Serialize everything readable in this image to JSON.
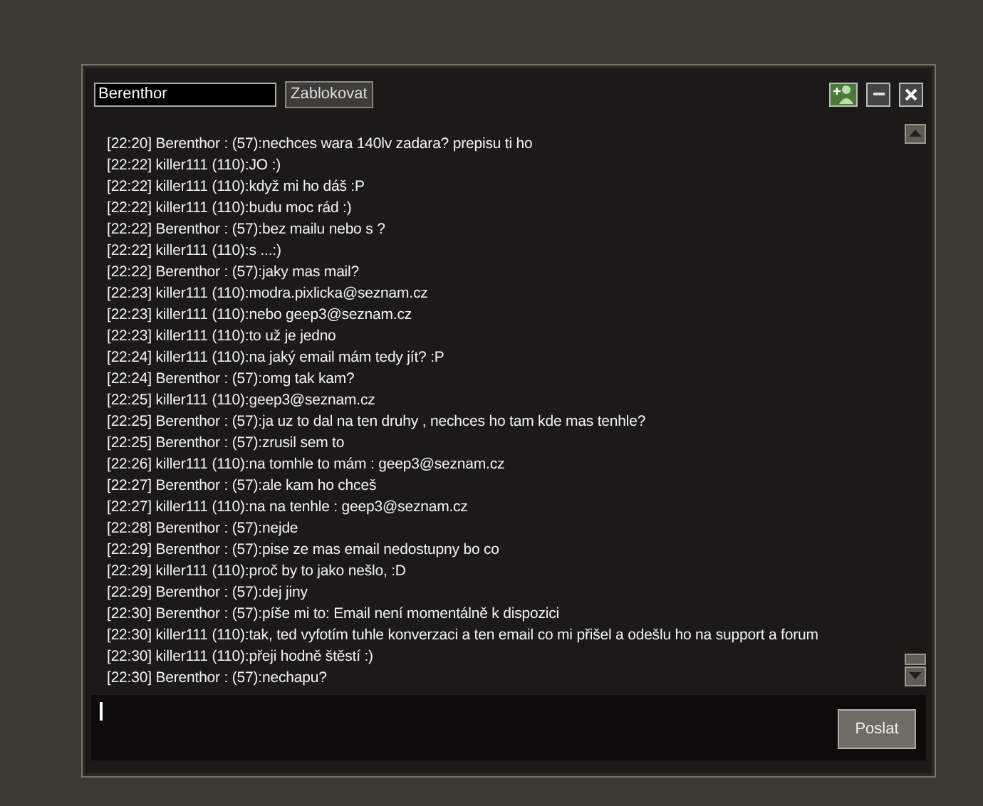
{
  "header": {
    "name_field": "Berenthor",
    "block_button": "Zablokovat"
  },
  "messages": [
    "[22:20] Berenthor : (57):nechces wara 140lv zadara? prepisu ti ho",
    "[22:22] killer111 (110):JO :)",
    "[22:22] killer111 (110):když mi ho dáš :P",
    "[22:22] killer111 (110):budu moc rád :)",
    "[22:22] Berenthor : (57):bez mailu nebo s ?",
    "[22:22] killer111 (110):s ...:)",
    "[22:22] Berenthor : (57):jaky mas mail?",
    "[22:23] killer111 (110):modra.pixlicka@seznam.cz",
    "[22:23] killer111 (110):nebo geep3@seznam.cz",
    "[22:23] killer111 (110):to už je jedno",
    "[22:24] killer111 (110):na jaký email mám tedy jít? :P",
    "[22:24] Berenthor : (57):omg tak kam?",
    "[22:25] killer111 (110):geep3@seznam.cz",
    "[22:25] Berenthor : (57):ja uz to dal na ten druhy , nechces ho tam kde mas tenhle?",
    "[22:25] Berenthor : (57):zrusil sem to",
    "[22:26] killer111 (110):na tomhle to mám : geep3@seznam.cz",
    "[22:27] Berenthor : (57):ale kam ho chceš",
    "[22:27] killer111 (110):na na tenhle : geep3@seznam.cz",
    "[22:28] Berenthor : (57):nejde",
    "[22:29] Berenthor : (57):pise ze mas email nedostupny bo co",
    "[22:29] killer111 (110):proč by to jako nešlo, :D",
    "[22:29] Berenthor : (57):dej jiny",
    "[22:30] Berenthor : (57):píše mi to: Email není momentálně k dispozici",
    "[22:30] killer111 (110):tak, ted vyfotím tuhle konverzaci a ten email co mi přišel a odešlu ho na support a forum",
    "[22:30] killer111 (110):přeji hodně štěstí :)",
    "[22:30] Berenthor : (57):nechapu?"
  ],
  "send_button": "Poslat"
}
